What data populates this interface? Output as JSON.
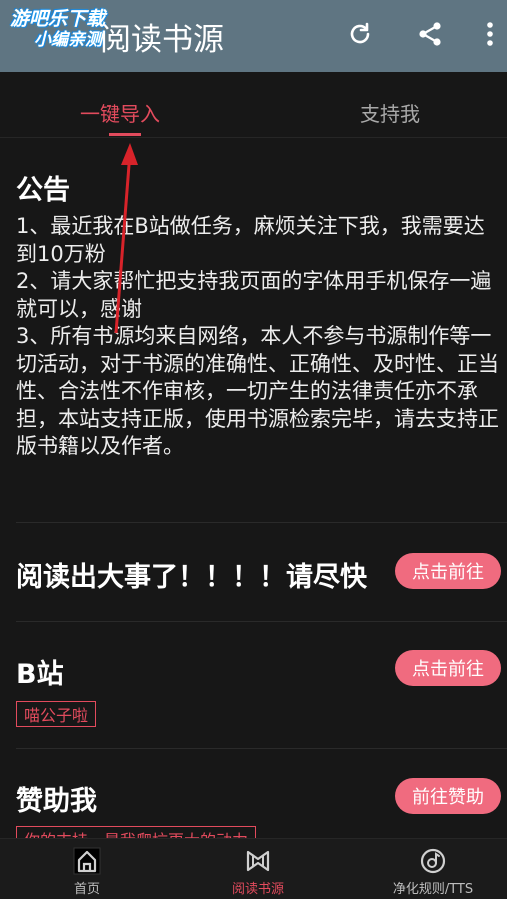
{
  "watermark": {
    "line1": "游吧乐下载",
    "line2": "小编亲测"
  },
  "appbar": {
    "title": "阅读书源"
  },
  "tabs": [
    {
      "label": "一键导入"
    },
    {
      "label": "支持我"
    }
  ],
  "notice": {
    "title": "公告",
    "lines": [
      "1、最近我在B站做任务，麻烦关注下我，我需要达到10万粉",
      "2、请大家帮忙把支持我页面的字体用手机保存一遍就可以，感谢",
      "3、所有书源均来自网络，本人不参与书源制作等一切活动，对于书源的准确性、正确性、及时性、正当性、合法性不作审核，一切产生的法律责任亦不承担，本站支持正版，使用书源检索完毕，请去支持正版书籍以及作者。"
    ]
  },
  "cards": [
    {
      "title": "阅读出大事了！！！！请尽快",
      "button": "点击前往"
    },
    {
      "title": "B站",
      "button": "点击前往",
      "tag": "喵公子啦"
    },
    {
      "title": "赞助我",
      "button": "前往赞助",
      "tag": "你的支持，是我爬坑更大的动力"
    }
  ],
  "bottom_nav": [
    {
      "label": "首页",
      "icon": "home-icon"
    },
    {
      "label": "阅读书源",
      "icon": "book-source-icon"
    },
    {
      "label": "净化规则/TTS",
      "icon": "purify-icon"
    }
  ],
  "colors": {
    "accent": "#e24b5d",
    "button": "#f06b7f",
    "appbar": "#5f7582",
    "background": "#171717"
  }
}
